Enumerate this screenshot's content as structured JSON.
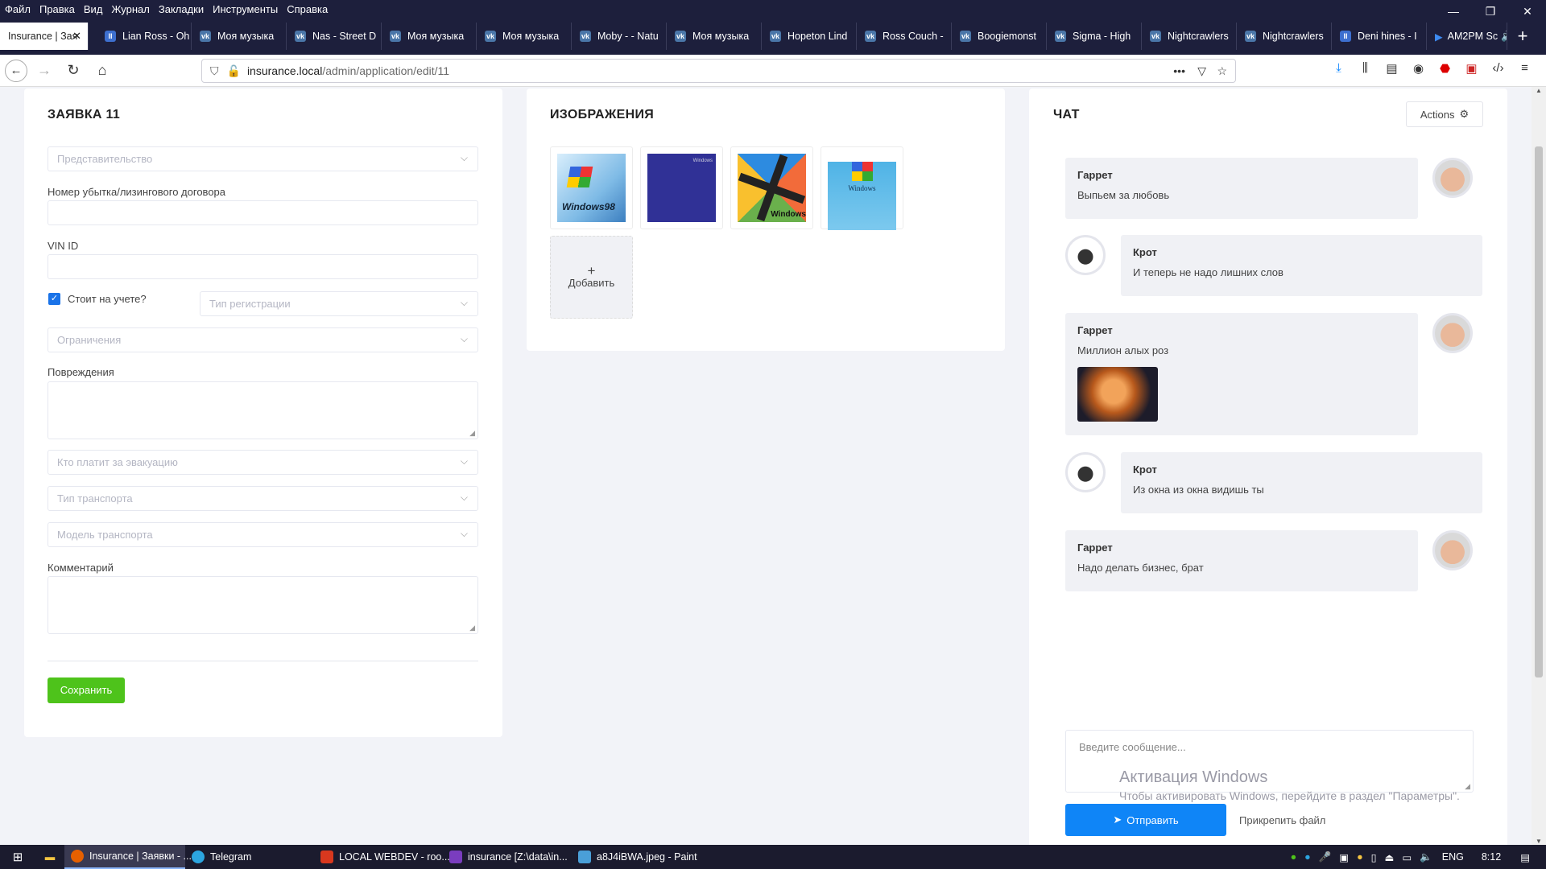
{
  "menu": [
    "Файл",
    "Правка",
    "Вид",
    "Журнал",
    "Закладки",
    "Инструменты",
    "Справка"
  ],
  "tabs": [
    {
      "label": "Insurance | Зая",
      "icon": "document-icon",
      "active": true
    },
    {
      "label": "Lian Ross - Oh",
      "icon": "pause-icon"
    },
    {
      "label": "Моя музыка",
      "icon": "vk-icon"
    },
    {
      "label": "Nas - Street D",
      "icon": "vk-icon"
    },
    {
      "label": "Моя музыка",
      "icon": "vk-icon"
    },
    {
      "label": "Моя музыка",
      "icon": "vk-icon"
    },
    {
      "label": "Moby - - Natu",
      "icon": "vk-icon"
    },
    {
      "label": "Моя музыка",
      "icon": "vk-icon"
    },
    {
      "label": "Hopeton Lind",
      "icon": "vk-icon"
    },
    {
      "label": "Ross Couch -",
      "icon": "vk-icon"
    },
    {
      "label": "Boogiemonst",
      "icon": "vk-icon"
    },
    {
      "label": "Sigma - High",
      "icon": "vk-icon"
    },
    {
      "label": "Nightcrawlers",
      "icon": "vk-icon"
    },
    {
      "label": "Nightcrawlers",
      "icon": "vk-icon"
    },
    {
      "label": "Deni hines - I",
      "icon": "pause-icon"
    },
    {
      "label": "AM2PM Sc",
      "icon": "play-icon"
    }
  ],
  "url": {
    "host": "insurance.local",
    "path": "/admin/application/edit/11"
  },
  "form": {
    "title": "ЗАЯВКА 11",
    "representation_placeholder": "Представительство",
    "contract_label": "Номер убытка/лизингового договора",
    "vin_label": "VIN ID",
    "registered_label": "Стоит на учете?",
    "registered_checked": true,
    "registration_type_placeholder": "Тип регистрации",
    "restrictions_placeholder": "Ограничения",
    "damage_label": "Повреждения",
    "evacuation_placeholder": "Кто платит за эвакуацию",
    "transport_type_placeholder": "Тип транспорта",
    "transport_model_placeholder": "Модель транспорта",
    "comment_label": "Комментарий",
    "save_label": "Сохранить"
  },
  "images": {
    "title": "ИЗОБРАЖЕНИЯ",
    "add_label": "Добавить",
    "thumbs": [
      "Windows98",
      "Windows",
      "Windows",
      "Windows"
    ]
  },
  "chat": {
    "title": "ЧАТ",
    "actions_label": "Actions",
    "messages": [
      {
        "name": "Гаррет",
        "text": "Выпьем за любовь",
        "side": "left"
      },
      {
        "name": "Крот",
        "text": "И теперь не надо лишних слов",
        "side": "right"
      },
      {
        "name": "Гаррет",
        "text": "Миллион алых роз",
        "side": "left",
        "has_image": true
      },
      {
        "name": "Крот",
        "text": "Из окна из окна видишь ты",
        "side": "right"
      },
      {
        "name": "Гаррет",
        "text": "Надо делать бизнес, брат",
        "side": "left"
      }
    ],
    "input_placeholder": "Введите сообщение...",
    "send_label": "Отправить",
    "attach_label": "Прикрепить файл"
  },
  "watermark": {
    "line1": "Активация Windows",
    "line2": "Чтобы активировать Windows, перейдите в раздел \"Параметры\"."
  },
  "taskbar": {
    "items": [
      {
        "label": "Insurance | Заявки - ...",
        "color": "#e66000"
      },
      {
        "label": "Telegram",
        "color": "#2ca5e0"
      },
      {
        "label": "LOCAL WEBDEV - roo...",
        "color": "#d9381e"
      },
      {
        "label": "insurance [Z:\\data\\in...",
        "color": "#7a3dbf"
      },
      {
        "label": "a8J4iBWA.jpeg - Paint",
        "color": "#4a9fd8"
      }
    ],
    "lang": "ENG",
    "time": "8:12"
  },
  "colors": {
    "accent": "#0f85f7",
    "save": "#4ec31b",
    "checkbox": "#1a73e8",
    "dark": "#1d1f3c"
  }
}
